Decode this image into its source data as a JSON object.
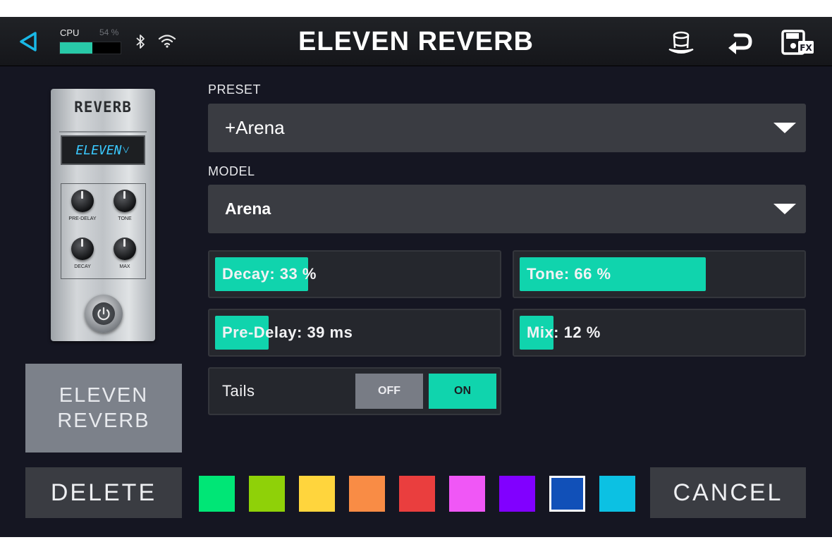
{
  "header": {
    "title": "ELEVEN REVERB",
    "cpu_label": "CPU",
    "cpu_percent": "54 %",
    "cpu_value": 0.54,
    "icons": [
      "back-icon",
      "bluetooth-icon",
      "wifi-icon",
      "top-hat-icon",
      "undo-icon",
      "save-fx-icon"
    ]
  },
  "pedal": {
    "name": "REVERB",
    "display": "ELEVEN˅",
    "knobs": [
      "PRE-DELAY",
      "TONE",
      "DECAY",
      "MAX"
    ]
  },
  "block_name": "ELEVEN\nREVERB",
  "preset": {
    "label": "PRESET",
    "value": "+Arena"
  },
  "model": {
    "label": "MODEL",
    "value": "Arena"
  },
  "params": [
    {
      "text": "Decay: 33 %",
      "value": 0.33
    },
    {
      "text": "Tone: 66 %",
      "value": 0.66
    },
    {
      "text": "Pre-Delay: 39 ms",
      "value": 0.19
    },
    {
      "text": "Mix: 12 %",
      "value": 0.12
    }
  ],
  "tails": {
    "label": "Tails",
    "off": "OFF",
    "on": "ON",
    "state": "ON"
  },
  "buttons": {
    "delete": "DELETE",
    "cancel": "CANCEL"
  },
  "colors": {
    "accent": "#10d4ad",
    "swatches": [
      "#00e676",
      "#8fd108",
      "#ffd53d",
      "#f98c45",
      "#ea3e3e",
      "#f057f6",
      "#8100ff",
      "#1150b8",
      "#0cc1e3"
    ],
    "selected_swatch": 7
  }
}
